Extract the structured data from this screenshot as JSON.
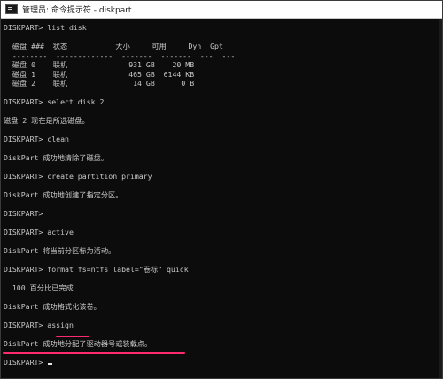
{
  "window": {
    "title": "管理员: 命令提示符 - diskpart"
  },
  "console": {
    "lines": [
      "DISKPART> list disk",
      "",
      "  磁盘 ###  状态           大小     可用     Dyn  Gpt",
      "  --------  -------------  -------  -------  ---  ---",
      "  磁盘 0    联机              931 GB    20 MB",
      "  磁盘 1    联机              465 GB  6144 KB",
      "  磁盘 2    联机               14 GB      0 B",
      "",
      "DISKPART> select disk 2",
      "",
      "磁盘 2 现在是所选磁盘。",
      "",
      "DISKPART> clean",
      "",
      "DiskPart 成功地清除了磁盘。",
      "",
      "DISKPART> create partition primary",
      "",
      "DiskPart 成功地创建了指定分区。",
      "",
      "DISKPART>",
      "",
      "DISKPART> active",
      "",
      "DiskPart 将当前分区标为活动。",
      "",
      "DISKPART> format fs=ntfs label=\"卷标\" quick",
      "",
      "  100 百分比已完成",
      "",
      "DiskPart 成功格式化该卷。",
      "",
      "DISKPART> assign",
      "",
      "DiskPart 成功地分配了驱动器号或装载点。",
      "",
      "DISKPART> "
    ]
  },
  "colors": {
    "console_background": "#0c0c0c",
    "console_text": "#c9c9c9",
    "highlight_underline": "#ff2a6d",
    "titlebar_background": "#ffffff"
  }
}
